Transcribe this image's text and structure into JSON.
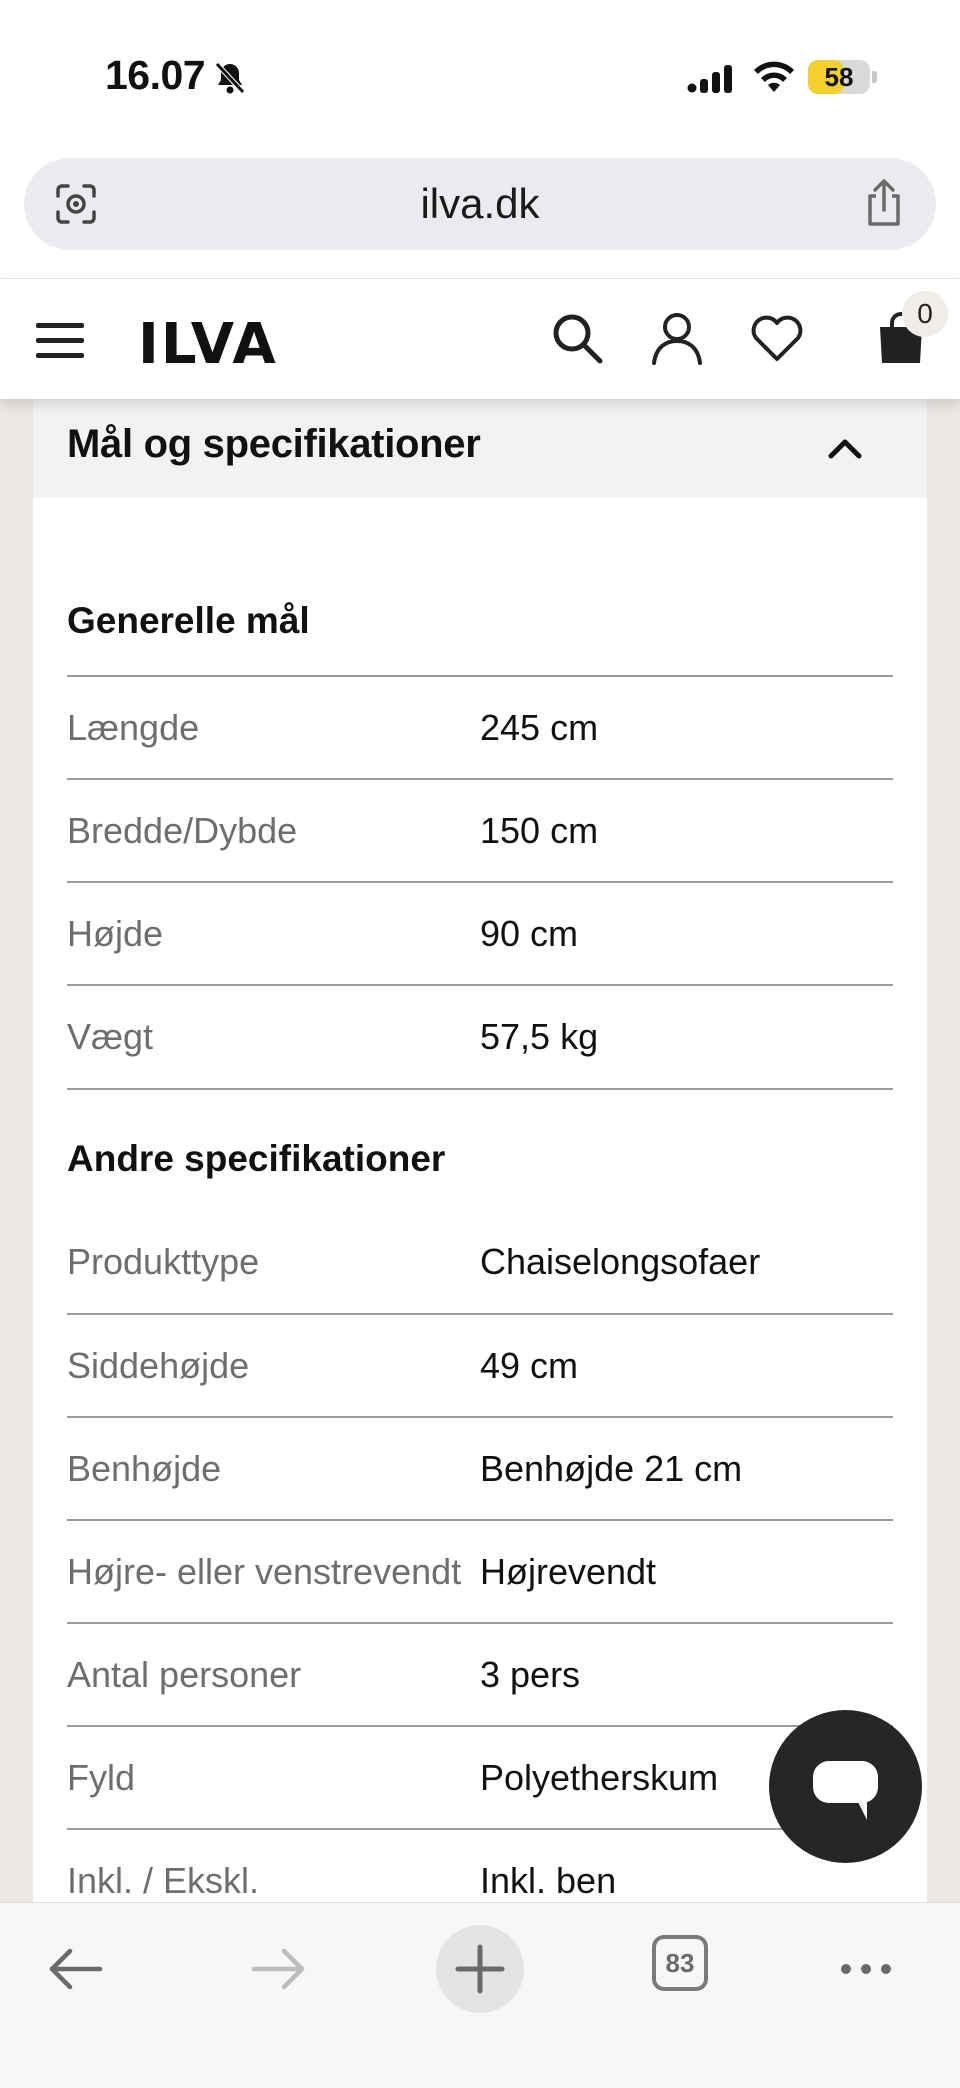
{
  "status_bar": {
    "time": "16.07",
    "battery_percent": "58",
    "battery_level": 0.58,
    "icons": [
      "bell-muted-icon",
      "cellular-signal-icon",
      "wifi-icon",
      "battery-icon"
    ]
  },
  "browser": {
    "url": "ilva.dk",
    "icons": [
      "camera-search-icon",
      "share-icon"
    ]
  },
  "site_header": {
    "logo": "ILVA",
    "cart_count": "0",
    "icons": [
      "menu-icon",
      "search-icon",
      "user-icon",
      "heart-icon",
      "bag-icon"
    ]
  },
  "accordion": {
    "title": "Mål og specifikationer",
    "expanded": true
  },
  "specs": {
    "general_title": "Generelle mål",
    "general": [
      {
        "label": "Længde",
        "value": "245 cm"
      },
      {
        "label": "Bredde/Dybde",
        "value": "150 cm"
      },
      {
        "label": "Højde",
        "value": "90 cm"
      },
      {
        "label": "Vægt",
        "value": "57,5 kg"
      }
    ],
    "other_title": "Andre specifikationer",
    "other": [
      {
        "label": "Produkttype",
        "value": "Chaiselongsofaer"
      },
      {
        "label": "Siddehøjde",
        "value": "49 cm"
      },
      {
        "label": "Benhøjde",
        "value": "Benhøjde 21 cm"
      },
      {
        "label": "Højre- eller venstrevendt",
        "value": "Højrevendt"
      },
      {
        "label": "Antal personer",
        "value": "3 pers"
      },
      {
        "label": "Fyld",
        "value": "Polyetherskum"
      },
      {
        "label": "Inkl. / Ekskl.",
        "value": "Inkl. ben"
      }
    ]
  },
  "toolbar": {
    "tab_count": "83",
    "icons": [
      "back-icon",
      "forward-icon",
      "new-tab-icon",
      "tabs-icon",
      "more-icon"
    ]
  },
  "colors": {
    "battery_fill": "#f4d02b",
    "panel_header_bg": "#f4f2f0",
    "page_side_bg": "#ece7e3",
    "chat_button": "#262626"
  }
}
